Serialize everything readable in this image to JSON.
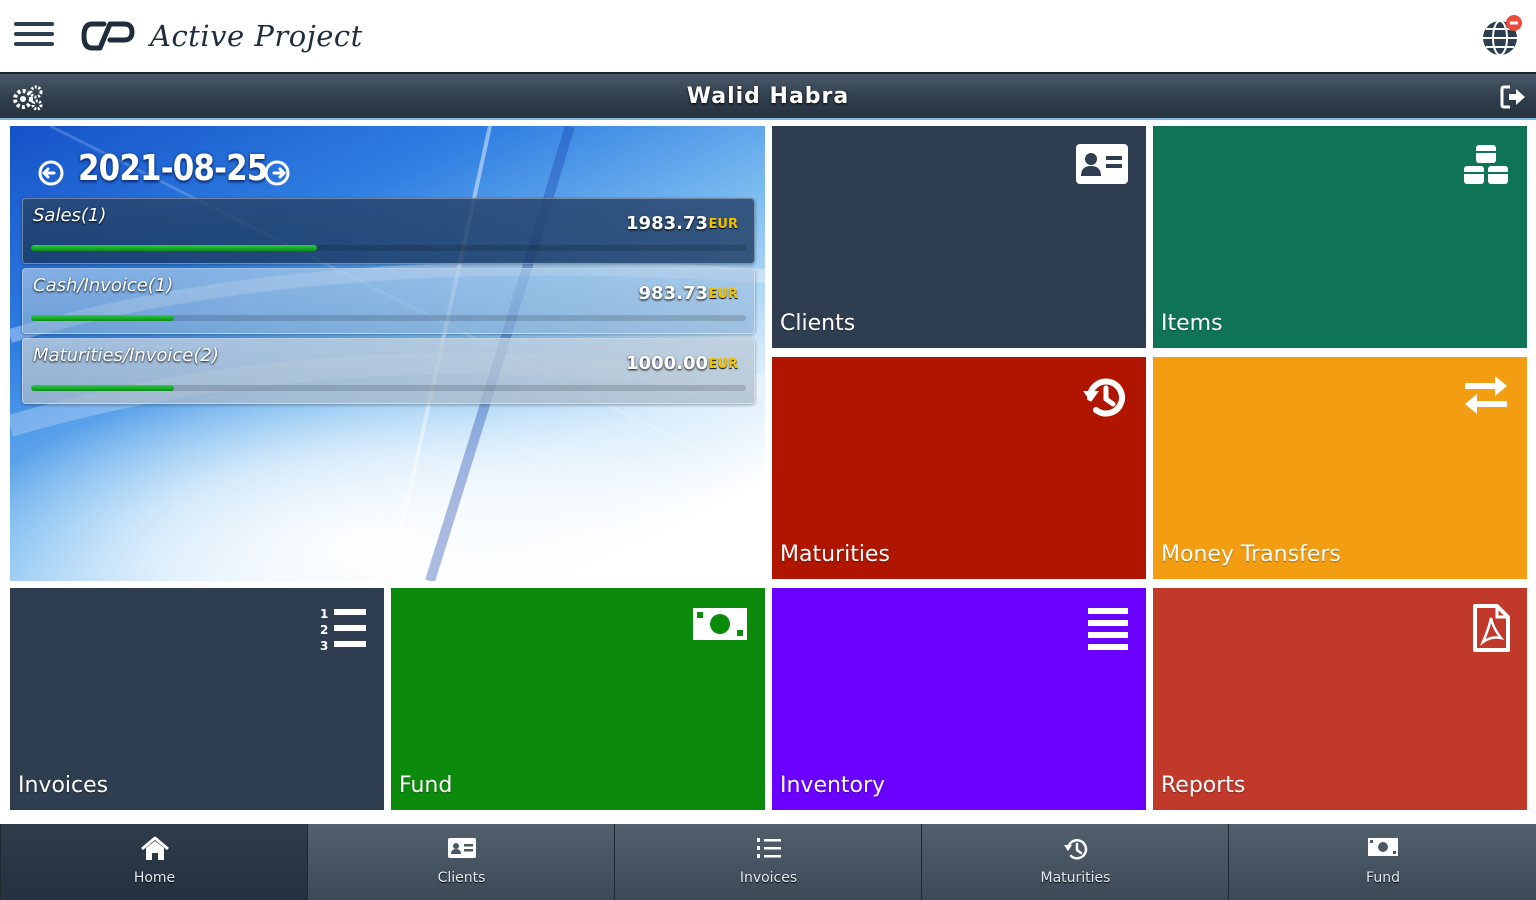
{
  "brand": {
    "name": "Active Project"
  },
  "user": {
    "name": "Walid Habra"
  },
  "summary": {
    "date": "2021-08-25",
    "rows": [
      {
        "label": "Sales(1)",
        "value": "1983.73",
        "currency": "EUR",
        "progress": 0.4
      },
      {
        "label": "Cash/Invoice(1)",
        "value": "983.73",
        "currency": "EUR",
        "progress": 0.2
      },
      {
        "label": "Maturities/Invoice(2)",
        "value": "1000.00",
        "currency": "EUR",
        "progress": 0.2
      }
    ]
  },
  "tiles": {
    "clients": {
      "label": "Clients",
      "color": "#2e3d4f",
      "icon": "id-card-icon"
    },
    "items": {
      "label": "Items",
      "color": "#0f7356",
      "icon": "cubes-icon"
    },
    "maturities": {
      "label": "Maturities",
      "color": "#b01500",
      "icon": "history-icon"
    },
    "money_transfers": {
      "label": "Money Transfers",
      "color": "#f29d12",
      "icon": "exchange-icon"
    },
    "invoices": {
      "label": "Invoices",
      "color": "#2e3d4f",
      "icon": "ordered-list-icon"
    },
    "fund": {
      "label": "Fund",
      "color": "#0c8a0c",
      "icon": "money-icon"
    },
    "inventory": {
      "label": "Inventory",
      "color": "#6a00ff",
      "icon": "bars-icon"
    },
    "reports": {
      "label": "Reports",
      "color": "#c0392b",
      "icon": "pdf-file-icon"
    }
  },
  "bottom_nav": [
    {
      "label": "Home",
      "icon": "home-icon",
      "active": true
    },
    {
      "label": "Clients",
      "icon": "id-card-icon",
      "active": false
    },
    {
      "label": "Invoices",
      "icon": "list-icon",
      "active": false
    },
    {
      "label": "Maturities",
      "icon": "history-icon",
      "active": false
    },
    {
      "label": "Fund",
      "icon": "money-icon",
      "active": false
    }
  ]
}
